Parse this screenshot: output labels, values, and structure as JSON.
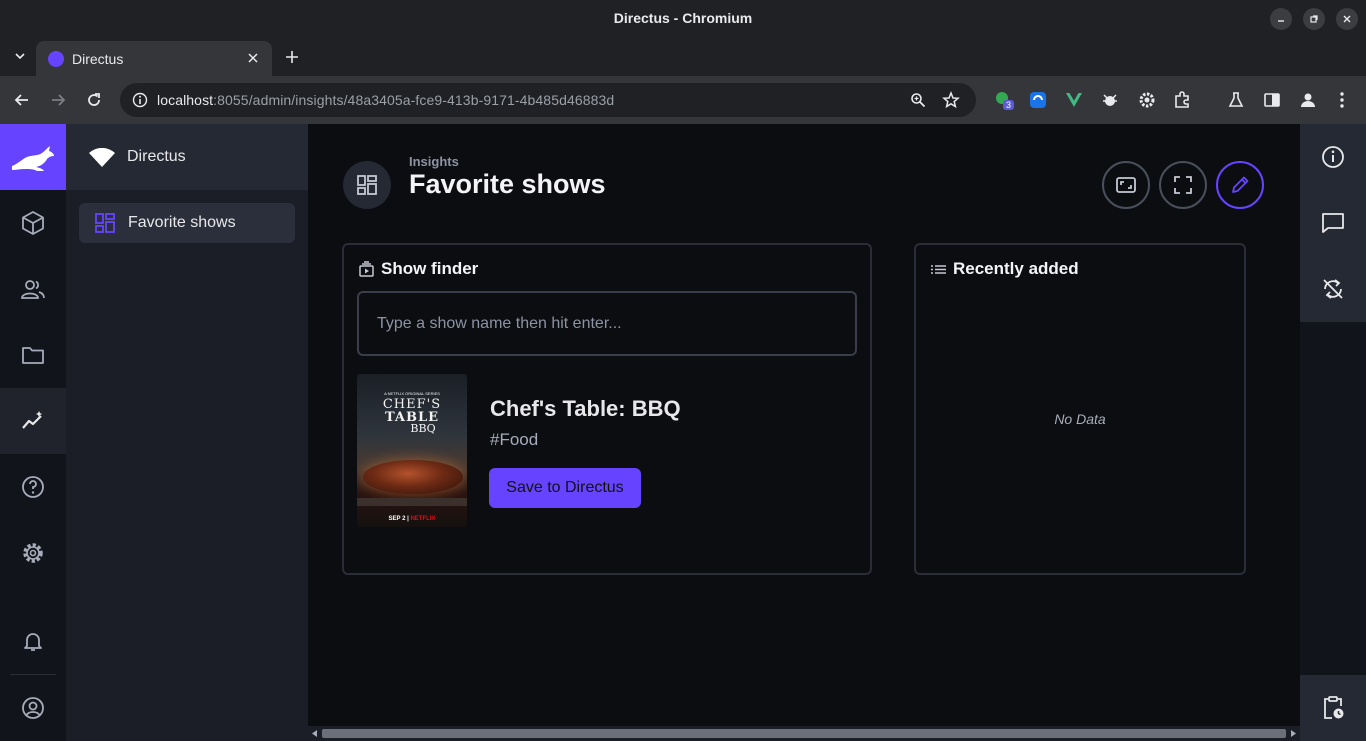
{
  "window": {
    "title": "Directus - Chromium"
  },
  "browser": {
    "tab_title": "Directus",
    "url_host": "localhost",
    "url_rest": ":8055/admin/insights/48a3405a-fce9-413b-9171-4b485d46883d",
    "extension_badge": "3"
  },
  "colors": {
    "accent": "#6644ff",
    "background": "#0c0d11",
    "panel_border": "#2a2d38",
    "nav_bg": "#1b1e26"
  },
  "nav": {
    "project_name": "Directus",
    "items": [
      {
        "label": "Favorite shows",
        "icon": "dashboard-icon",
        "active": true
      }
    ]
  },
  "rail": {
    "modules": [
      "content-icon",
      "users-icon",
      "files-icon",
      "insights-icon",
      "help-icon",
      "settings-icon"
    ],
    "active": "insights-icon"
  },
  "header": {
    "breadcrumb": "Insights",
    "title": "Favorite shows"
  },
  "panels": {
    "show_finder": {
      "title": "Show finder",
      "search_placeholder": "Type a show name then hit enter...",
      "result": {
        "title": "Chef's Table: BBQ",
        "tag": "#Food",
        "button_label": "Save to Directus",
        "poster": {
          "series": "A NETFLIX ORIGINAL SERIES",
          "line1": "CHEF'S",
          "line2": "TABLE",
          "line3": "BBQ",
          "date": "SEP 2",
          "brand": "NETFLIX"
        }
      }
    },
    "recently_added": {
      "title": "Recently added",
      "empty_text": "No Data"
    }
  }
}
